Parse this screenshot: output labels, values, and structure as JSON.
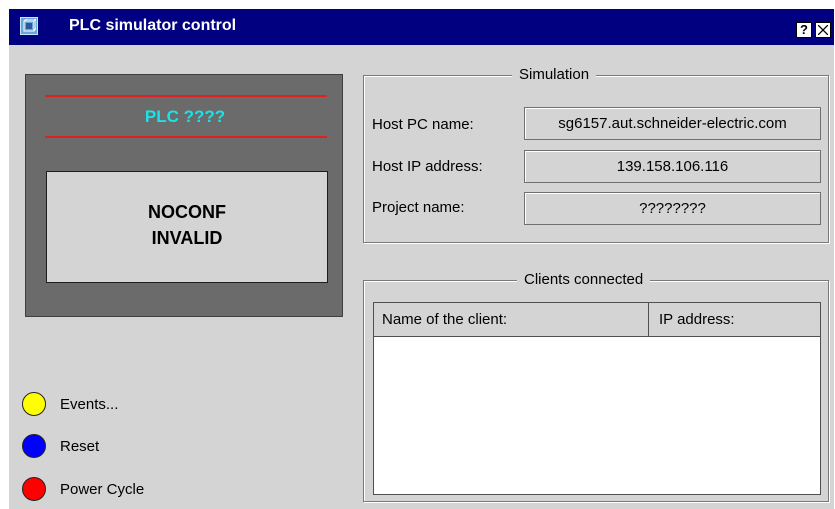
{
  "window": {
    "title": "PLC simulator control",
    "help_button": "?",
    "icon": "app-icon"
  },
  "plc": {
    "name": "PLC ????",
    "state_line1": "NOCONF",
    "state_line2": "INVALID"
  },
  "buttons": [
    {
      "label": "Events...",
      "color": "#ffff00"
    },
    {
      "label": "Reset",
      "color": "#0000ff"
    },
    {
      "label": "Power Cycle",
      "color": "#ff0000"
    }
  ],
  "simulation": {
    "title": "Simulation",
    "fields": [
      {
        "label": "Host PC name:",
        "value": "sg6157.aut.schneider-electric.com"
      },
      {
        "label": "Host IP address:",
        "value": "139.158.106.116"
      },
      {
        "label": "Project name:",
        "value": "????????"
      }
    ]
  },
  "clients": {
    "title": "Clients connected",
    "columns": [
      "Name of the client:",
      "IP address:"
    ],
    "rows": []
  },
  "colors": {
    "titlebar": "#000080",
    "plc_name": "#19e3e8",
    "separator": "#e02020",
    "panel": "#6b6b6b"
  }
}
